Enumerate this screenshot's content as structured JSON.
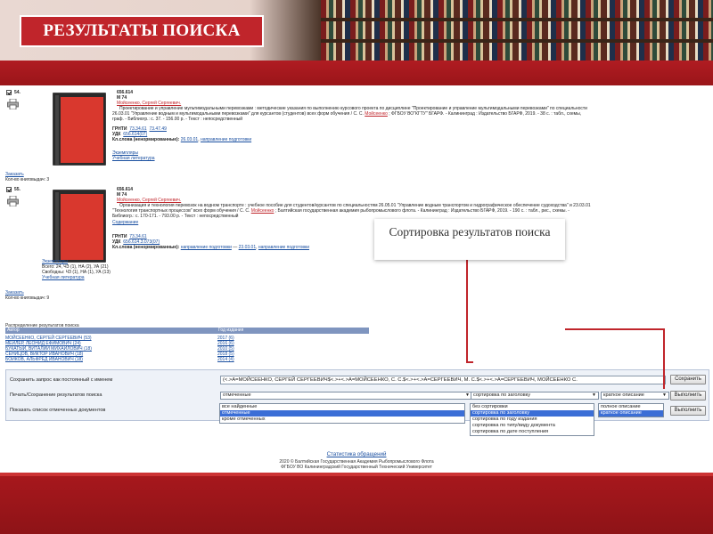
{
  "header": {
    "title": "РЕЗУЛЬТАТЫ ПОИСКА"
  },
  "records": [
    {
      "number": "54.",
      "code": "656.614",
      "sign": "М 74",
      "author": "Мойсеенко, Сергей Сергеевич.",
      "line1": "Проектирование и управление мультимодальными перевозками : методические указания по выполнению курсового проекта по дисциплине \"Проектирование и управление мультимодальными перевозками\" по специальности",
      "line2": "26.03.01 \"Управление водным и мультимодальными перевозками\" для курсантов (студентов) всех форм обучения / С. С.",
      "line2_author": "Мойсеенко",
      "line2_rest": "; ФГБОУ ВО\"КГТУ\" БГАРФ. - Калининград : Издательство БГАРФ, 2019. - 38 с. : табл., схемы,",
      "line3": "граф. - Библиогр.: с. 37. - 156.00 р. - Текст : непосредственный",
      "grnti_label": "ГРНТИ",
      "grnti_values": [
        "73.34.61",
        "73.47.49"
      ],
      "udk_label": "УДК",
      "udk_value": "656.614(07)",
      "kl_label": "Кл.слова (ненормированные):",
      "kl_values": [
        "26.03.01",
        "направление подготовки"
      ],
      "links": [
        "Экземпляры",
        "Учебная литература"
      ],
      "order": "Заказать",
      "count": "Кол-во книговыдач: 3"
    },
    {
      "number": "55.",
      "code": "656.614",
      "sign": "М 74",
      "author": "Мойсеенко, Сергей Сергеевич.",
      "line1": "Организация и технология перевозок на водном транспорте : учебное пособие для студентов/курсантов по специальностям 26.05.01 \"Управление водным транспортом и гидрографическое обеспечение судоходства\" и 23.03.01",
      "line2": "\"Технология транспортных процессов\" всех форм обучения / С. С.",
      "line2_author": "Мойсеенко",
      "line2_rest": "; Балтийская государственная академия рыбопромыслового флота. - Калининград : Издательство БГАРФ, 2019. - 190 с. : табл., рис., схемы. -",
      "line3": "Библиогр.: с. 170-171. - 793.00 р. - Текст : непосредственный",
      "contents": "Содержание",
      "grnti_label": "ГРНТИ",
      "grnti_values": [
        "73.34.61"
      ],
      "udk_label": "УДК",
      "udk_value": "656.614.3.073(07)",
      "kl_label": "Кл.слова (ненормированные):",
      "kl_values": [
        "направление подготовки",
        "23.03.01",
        "направление подготовки"
      ],
      "copies": "Экземпляры",
      "all_copies": "Всего: 24, ЧЗ (1), НА (2), УА (21)",
      "free_copies": "Свободны: ЧЗ (1), НА (1), УА (13)",
      "study": "Учебная литература",
      "order": "Заказать",
      "count": "Кол-во книговыдач: 9"
    }
  ],
  "distribution": {
    "title": "Распределение результатов поиска",
    "col_author": "Автор",
    "col_year": "Год издания",
    "rows": [
      {
        "author": "МОЙСЕЕНКО, СЕРГЕЙ СЕРГЕЕВИЧ (53)",
        "year": "2017 (6)"
      },
      {
        "author": "МЕЙЛЕР, ЛЕОНИД ЕФИМОВИЧ (24)",
        "year": "2016 (6)"
      },
      {
        "author": "БУКАТЫЙ, ВИТАЛИЙ МИХАЙЛОВИЧ (18)",
        "year": "2010 (5)"
      },
      {
        "author": "СЕНИЦОВ, ВИКТОР ИВАНОВИЧ (18)",
        "year": "2018 (5)"
      },
      {
        "author": "БОЙКОВ, АЛЬФРЕД ИВАНОВИЧ (18)",
        "year": "2014 (4)"
      }
    ]
  },
  "panel": {
    "save_query_label": "Сохранить запрос как постоянный с именем",
    "query_value": "(<.>A=МОЙСЕЕНКО, СЕРГЕЙ СЕРГЕЕВИЧ$<.>+<.>A=МОЙСЕЕНКО, С. С.$<.>+<.>A=СЕРГЕЕВИЧ, М. С.$<.>+<.>A=СЕРГЕЕВИЧ, МОЙСЕЕНКО С.",
    "save_button": "Сохранить",
    "print_label": "Печать/Сохранение результатов поиска",
    "print_select": "отмеченные",
    "print_options": [
      "все найденные",
      "отмеченные",
      "кроме отмеченных"
    ],
    "print_selected_index": 1,
    "sort_select": "сортировка по заголовку",
    "sort_options": [
      "без сортировки",
      "сортировка по заголовку",
      "сортировка по году издания",
      "сортировка по типу/виду документа",
      "сортировка по дате поступления"
    ],
    "sort_selected_index": 1,
    "desc_select": "краткое описание",
    "desc_options": [
      "полное описание",
      "краткое описание"
    ],
    "desc_selected_index": 1,
    "run_button": "Выполнить",
    "show_marked_label": "Показать список отмеченных документов",
    "run_button2": "Выполнить"
  },
  "footer": {
    "stats_link": "Статистика обращений",
    "line1": "2020 © Балтийская Государственная Академия Рыбопромыслового Флота",
    "line2": "ФГБОУ ВО Калининградский Государственный Технический Университет"
  },
  "callout": {
    "text": "Сортировка результатов поиска"
  },
  "colors": {
    "accent_red": "#c0252b",
    "link_blue": "#1a4fa0",
    "selection_blue": "#3b6ed6"
  },
  "icons": {
    "printer": "printer-icon",
    "checkbox": "checkbox-icon"
  }
}
